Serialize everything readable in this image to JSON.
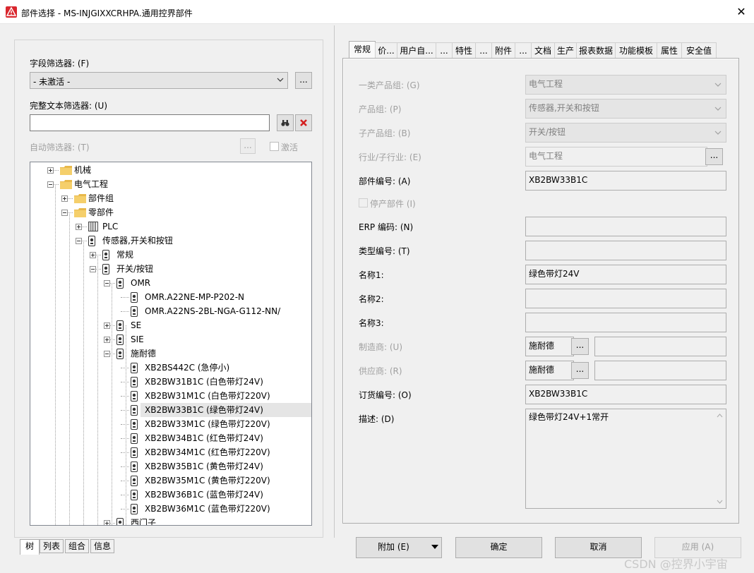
{
  "window": {
    "title": "部件选择 - MS-INJGIXXCRHPA.通用控界部件",
    "close_symbol": "✕"
  },
  "left": {
    "field_filter_label": "字段筛选器: (F)",
    "field_filter_value": "- 未激活 -",
    "dots": "...",
    "fulltext_label": "完整文本筛选器: (U)",
    "fulltext_value": "",
    "auto_filter_label": "自动筛选器: (T)",
    "activate_label": "激活",
    "tree": [
      {
        "label": "机械",
        "level": 1,
        "icon": "folder-icon",
        "expander": "plus"
      },
      {
        "label": "电气工程",
        "level": 1,
        "icon": "folder-icon",
        "expander": "minus"
      },
      {
        "label": "部件组",
        "level": 2,
        "icon": "folder-icon",
        "expander": "plus"
      },
      {
        "label": "零部件",
        "level": 2,
        "icon": "folder-icon",
        "expander": "minus"
      },
      {
        "label": "PLC",
        "level": 3,
        "icon": "plc-icon",
        "expander": "plus"
      },
      {
        "label": "传感器,开关和按钮",
        "level": 3,
        "icon": "device-icon",
        "expander": "minus"
      },
      {
        "label": "常规",
        "level": 4,
        "icon": "device-icon",
        "expander": "plus"
      },
      {
        "label": "开关/按钮",
        "level": 4,
        "icon": "device-icon",
        "expander": "minus"
      },
      {
        "label": "OMR",
        "level": 5,
        "icon": "device-icon",
        "expander": "minus"
      },
      {
        "label": "OMR.A22NE-MP-P202-N",
        "level": 6,
        "icon": "device-icon",
        "expander": ""
      },
      {
        "label": "OMR.A22NS-2BL-NGA-G112-NN/",
        "level": 6,
        "icon": "device-icon",
        "expander": ""
      },
      {
        "label": "SE",
        "level": 5,
        "icon": "device-icon",
        "expander": "plus"
      },
      {
        "label": "SIE",
        "level": 5,
        "icon": "device-icon",
        "expander": "plus"
      },
      {
        "label": "施耐德",
        "level": 5,
        "icon": "device-icon",
        "expander": "minus"
      },
      {
        "label": "XB2BS442C (急停小)",
        "level": 6,
        "icon": "device-icon",
        "expander": ""
      },
      {
        "label": "XB2BW31B1C (白色带灯24V)",
        "level": 6,
        "icon": "device-icon",
        "expander": ""
      },
      {
        "label": "XB2BW31M1C (白色带灯220V)",
        "level": 6,
        "icon": "device-icon",
        "expander": ""
      },
      {
        "label": "XB2BW33B1C (绿色带灯24V)",
        "level": 6,
        "icon": "device-icon",
        "expander": "",
        "selected": true
      },
      {
        "label": "XB2BW33M1C (绿色带灯220V)",
        "level": 6,
        "icon": "device-icon",
        "expander": ""
      },
      {
        "label": "XB2BW34B1C (红色带灯24V)",
        "level": 6,
        "icon": "device-icon",
        "expander": ""
      },
      {
        "label": "XB2BW34M1C (红色带灯220V)",
        "level": 6,
        "icon": "device-icon",
        "expander": ""
      },
      {
        "label": "XB2BW35B1C (黄色带灯24V)",
        "level": 6,
        "icon": "device-icon",
        "expander": ""
      },
      {
        "label": "XB2BW35M1C (黄色带灯220V)",
        "level": 6,
        "icon": "device-icon",
        "expander": ""
      },
      {
        "label": "XB2BW36B1C (蓝色带灯24V)",
        "level": 6,
        "icon": "device-icon",
        "expander": ""
      },
      {
        "label": "XB2BW36M1C (蓝色带灯220V)",
        "level": 6,
        "icon": "device-icon",
        "expander": ""
      },
      {
        "label": "西门子",
        "level": 5,
        "icon": "device-icon",
        "expander": "plus"
      }
    ],
    "bottom_tabs": [
      "树",
      "列表",
      "组合",
      "信息"
    ]
  },
  "right": {
    "tabs": [
      "常规",
      "价...",
      "用户自...",
      "...",
      "特性",
      "...",
      "附件",
      "...",
      "文档",
      "生产",
      "报表数据",
      "功能模板",
      "属性",
      "安全值"
    ],
    "fields": {
      "category_label": "一类产品组: (G)",
      "category_value": "电气工程",
      "group_label": "产品组: (P)",
      "group_value": "传感器,开关和按钮",
      "subgroup_label": "子产品组: (B)",
      "subgroup_value": "开关/按钮",
      "industry_label": "行业/子行业: (E)",
      "industry_value": "电气工程",
      "partno_label": "部件编号: (A)",
      "partno_value": "XB2BW33B1C",
      "discontinued_label": "停产部件 (I)",
      "erp_label": "ERP 编码: (N)",
      "erp_value": "",
      "type_label": "类型编号: (T)",
      "type_value": "",
      "name1_label": "名称1:",
      "name1_value": "绿色带灯24V",
      "name2_label": "名称2:",
      "name2_value": "",
      "name3_label": "名称3:",
      "name3_value": "",
      "manufacturer_label": "制造商: (U)",
      "manufacturer_value": "施耐德",
      "manufacturer_extra": "",
      "supplier_label": "供应商: (R)",
      "supplier_value": "施耐德",
      "supplier_extra": "",
      "orderno_label": "订货编号: (O)",
      "orderno_value": "XB2BW33B1C",
      "desc_label": "描述: (D)",
      "desc_value": "绿色带灯24V+1常开"
    }
  },
  "buttons": {
    "add": "附加 (E)",
    "ok": "确定",
    "cancel": "取消",
    "apply": "应用 (A)"
  },
  "watermark": "CSDN @控界小宇宙"
}
